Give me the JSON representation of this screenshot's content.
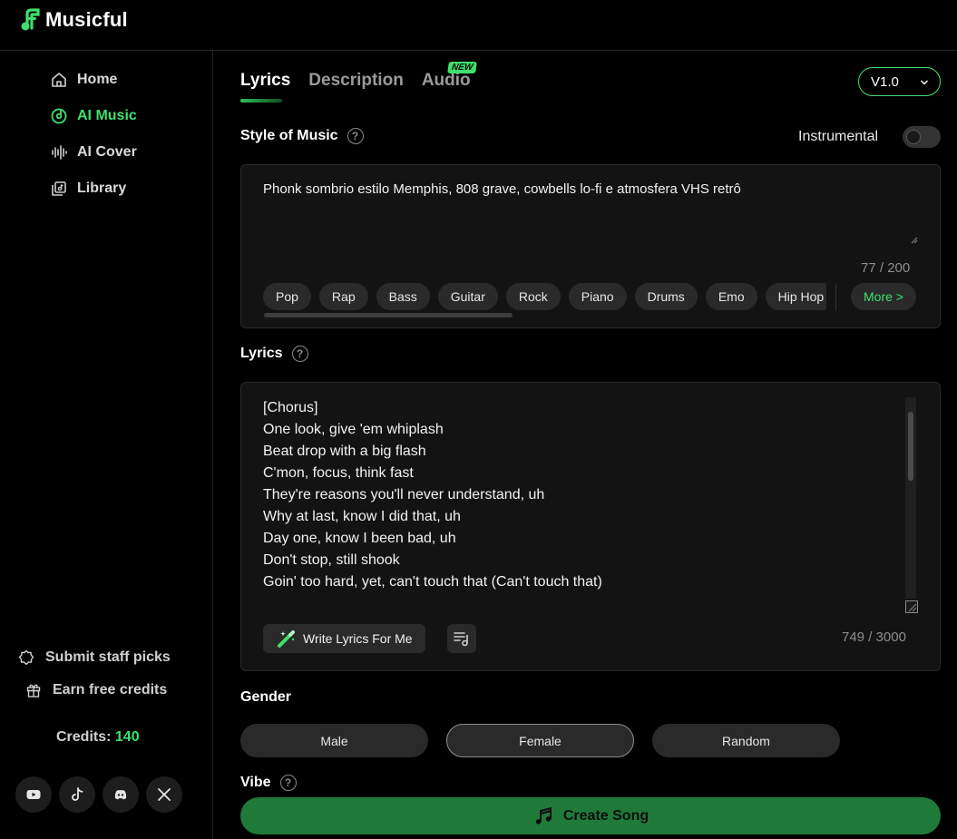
{
  "app": {
    "name": "Musicful",
    "accent": "#3ee06b"
  },
  "sidebar": {
    "items": [
      {
        "label": "Home",
        "icon": "home-icon",
        "active": false
      },
      {
        "label": "AI Music",
        "icon": "disc-icon",
        "active": true
      },
      {
        "label": "AI Cover",
        "icon": "waveform-icon",
        "active": false
      },
      {
        "label": "Library",
        "icon": "library-icon",
        "active": false
      }
    ],
    "submit_staff_picks": "Submit staff picks",
    "earn_free_credits": "Earn free credits",
    "credits_label": "Credits:",
    "credits_value": "140",
    "socials": [
      "youtube-icon",
      "tiktok-icon",
      "discord-icon",
      "x-icon"
    ]
  },
  "tabs": {
    "items": [
      "Lyrics",
      "Description",
      "Audio"
    ],
    "active": "Lyrics",
    "new_badge": "NEW"
  },
  "version": {
    "selected": "V1.0"
  },
  "style_section": {
    "title": "Style of Music",
    "instrumental_label": "Instrumental",
    "instrumental_on": false,
    "text": "Phonk sombrio estilo Memphis, 808 grave, cowbells lo-fi e atmosfera VHS retrô",
    "count": "77",
    "max": "200",
    "chips": [
      "Pop",
      "Rap",
      "Bass",
      "Guitar",
      "Rock",
      "Piano",
      "Drums",
      "Emo",
      "Hip Hop"
    ],
    "more_label": "More >"
  },
  "lyrics_section": {
    "title": "Lyrics",
    "lines": [
      "[Chorus]",
      "One look, give 'em whiplash",
      "Beat drop with a big flash",
      "C'mon, focus, think fast",
      "They're reasons you'll never understand, uh",
      "Why at last, know I did that, uh",
      "Day one, know I been bad, uh",
      "Don't stop, still shook",
      "Goin' too hard, yet, can't touch that (Can't touch that)"
    ],
    "write_button": "Write Lyrics For Me",
    "count": "749",
    "max": "3000"
  },
  "gender_section": {
    "title": "Gender",
    "options": [
      "Male",
      "Female",
      "Random"
    ],
    "selected": "Female"
  },
  "vibe_section": {
    "title": "Vibe"
  },
  "create_button": "Create Song"
}
